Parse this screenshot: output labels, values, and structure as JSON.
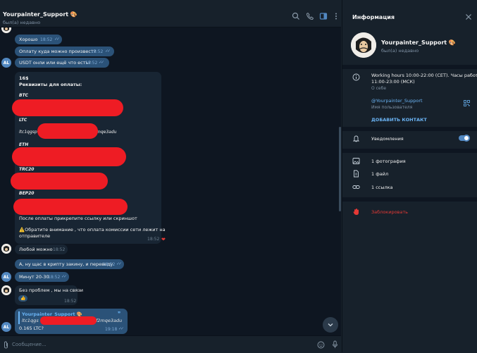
{
  "header": {
    "title": "Yourpainter_Support 🎨",
    "status": "был(а) недавно"
  },
  "messages": {
    "m1": {
      "text": "Хорошо",
      "time": "18:52"
    },
    "m2": {
      "text": "Оплату куда можно произвест?",
      "time": "18:52"
    },
    "m3": {
      "text": "USDT онли или ещё что есть?",
      "time": "18:52"
    },
    "big": {
      "l1": "16$",
      "l2": "Реквизиты для оплаты:",
      "btc": "BTC",
      "ltc": "LTC",
      "ltc_addr_a": "ltc1qgsp",
      "ltc_addr_b": "mqe3adu",
      "eth": "ETH",
      "trc20": "TRC20",
      "bep20": "BEP20",
      "after": "После оплаты прикрепите ссылку или скриншот",
      "warn1": "⚠️Обратите внимание , что оплата комиссии сети лежит на",
      "warn2": "отправителе",
      "time": "18:52",
      "heart": "❤"
    },
    "m4": {
      "text": "Любой можно",
      "time": "18:52"
    },
    "m5": {
      "text": "А, ну щас в крипту закину, и переведу",
      "time": "18:52"
    },
    "m6": {
      "text": "Минут 20-30",
      "time": "18:52"
    },
    "m7": {
      "text": "Без проблем , мы на связи",
      "time": "18:52",
      "reaction": "👍"
    },
    "m8": {
      "quote_name": "Yourpainter_Support 🎨",
      "quote_a": "ltc1qgs",
      "quote_b": "f2mqe3adu",
      "text": "0.165 LTC?",
      "time": "19:18"
    }
  },
  "avatar_label": "AL",
  "input": {
    "placeholder": "Сообщение..."
  },
  "panel": {
    "title": "Информация",
    "name": "Yourpainter_Support 🎨",
    "status": "был(а) недавно",
    "hours1": "Working hours 10:00-22:00 (CET). Часы работы",
    "hours2": "11:00-23:00 (МСК)",
    "about_label": "О себе",
    "username": "@Yourpainter_Support",
    "username_label": "Имя пользователя",
    "add_contact": "ДОБАВИТЬ КОНТАКТ",
    "notifications": "Уведомления",
    "photos": "1 фотография",
    "files": "1 файл",
    "links": "1 ссылка",
    "block": "Заблокировать"
  },
  "colors": {
    "accent": "#5288c1",
    "link": "#6ab3f3",
    "danger": "#e53935",
    "redaction": "#ee1c24"
  }
}
